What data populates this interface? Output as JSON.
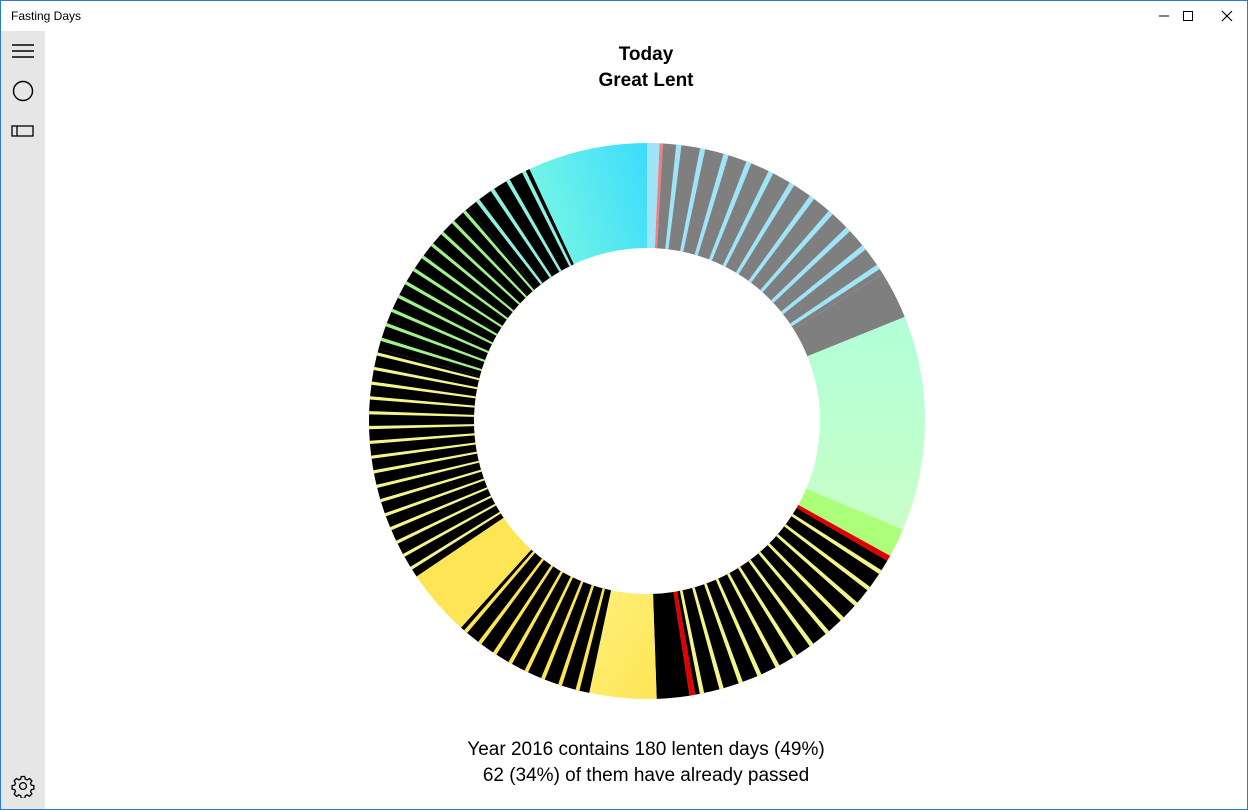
{
  "window": {
    "title": "Fasting Days"
  },
  "sidebar": {
    "icons": [
      "hamburger-menu-icon",
      "circle-view-icon",
      "linear-view-icon",
      "gear-icon"
    ]
  },
  "main": {
    "heading": "Today",
    "subheading": "Great Lent",
    "summary_line1": "Year 2016 contains 180 lenten days (49%)",
    "summary_line2": "62 (34%) of them have already passed"
  },
  "palette": {
    "black": "#000000",
    "grey": "#7f7f7f",
    "light_blue": "#9fe5f7",
    "cyan_start": "#73f5e6",
    "cyan_end": "#3cdcfc",
    "pale_green_start": "#c9ffc8",
    "pale_green_end": "#b0ffd8",
    "lime": "#acff78",
    "green_stripe": "#9ff28a",
    "yellow_stripe": "#f3f58c",
    "yellow": "#fde555",
    "red": "#e00000",
    "pink": "#f08080",
    "aqua_stripe": "#8ff0e0"
  }
}
